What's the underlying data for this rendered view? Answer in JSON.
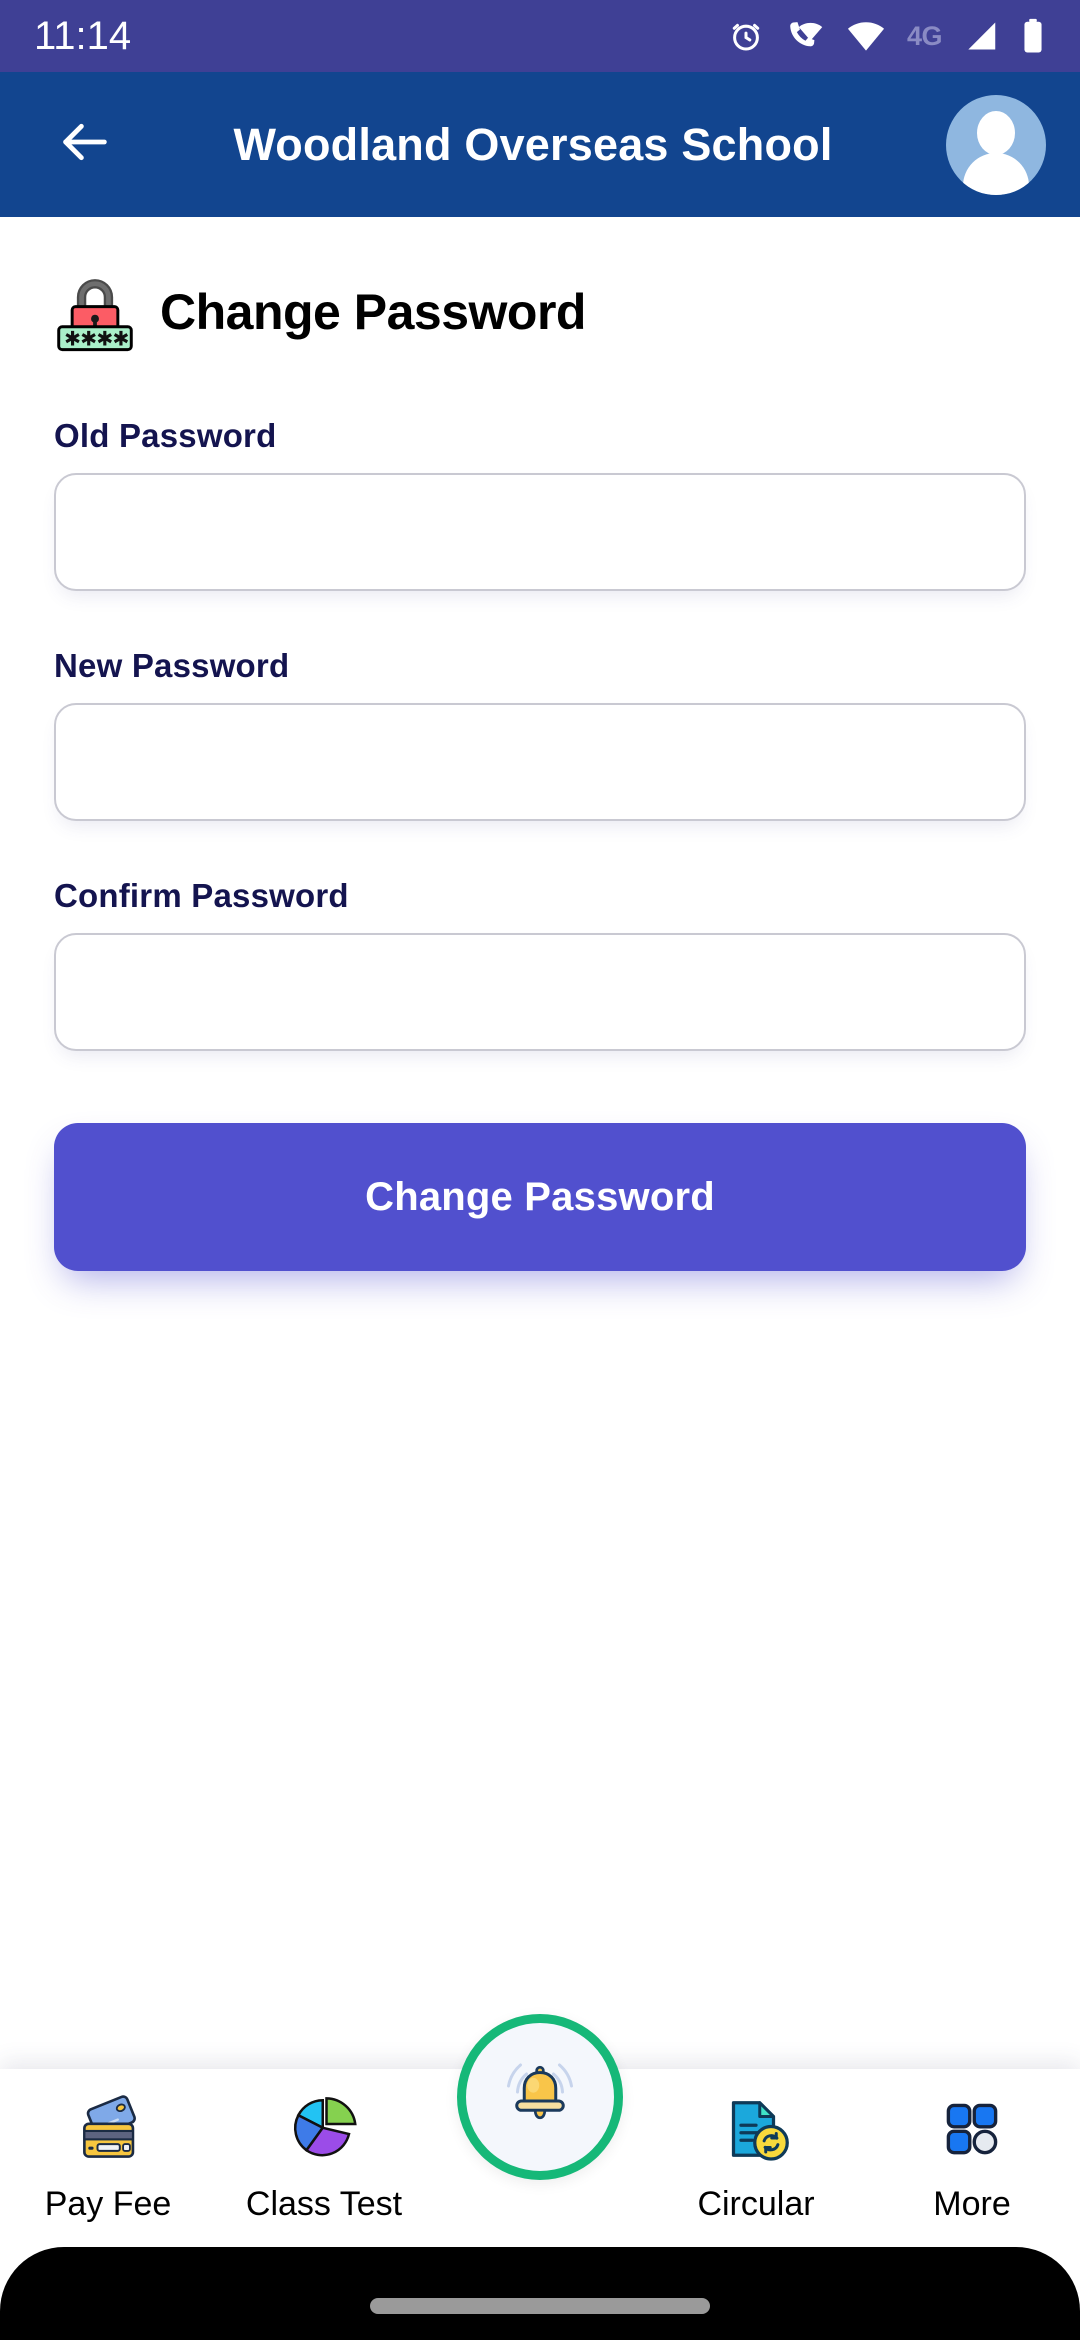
{
  "status_bar": {
    "time": "11:14",
    "network_label": "4G",
    "icons": [
      "alarm-clock-icon",
      "vowifi-call-icon",
      "wifi-icon",
      "network-4g-label",
      "signal-bars-icon",
      "battery-icon"
    ],
    "background_color": "#3F4095",
    "text_color": "#FFFFFF"
  },
  "app_bar": {
    "back_icon": "arrow-left-icon",
    "title": "Woodland Overseas School",
    "avatar_icon": "user-avatar-icon",
    "background_color": "#12458F",
    "avatar_background_color": "#8FB7E0"
  },
  "page": {
    "icon": "locked-with-key-password-emoji",
    "title": "Change Password",
    "title_color": "#000000"
  },
  "form": {
    "fields": [
      {
        "name": "old-password",
        "label": "Old Password",
        "value": "",
        "placeholder": ""
      },
      {
        "name": "new-password",
        "label": "New Password",
        "value": "",
        "placeholder": ""
      },
      {
        "name": "confirm-password",
        "label": "Confirm Password",
        "value": "",
        "placeholder": ""
      }
    ],
    "label_color": "#14144F",
    "input_border_color": "#C9C9D2",
    "submit_label": "Change Password",
    "submit_color": "#5150CE",
    "submit_text_color": "#FFFFFF"
  },
  "bottom_nav": {
    "items": [
      {
        "label": "Pay Fee",
        "icon": "credit-cards-icon"
      },
      {
        "label": "Class Test",
        "icon": "pie-chart-icon"
      },
      {
        "label": "",
        "icon": "notification-bell-icon"
      },
      {
        "label": "Circular",
        "icon": "document-refresh-icon"
      },
      {
        "label": "More",
        "icon": "grid-apps-icon"
      }
    ],
    "fab": {
      "icon": "notification-bell-icon",
      "ring_color": "#16B878",
      "fill_color": "#F4F7FC"
    },
    "label_color": "#000000",
    "background_color": "#FFFFFF"
  },
  "gesture_bar": {
    "handle": "home-gesture-handle",
    "background_color": "#000000",
    "handle_color": "#9A9A9A"
  }
}
